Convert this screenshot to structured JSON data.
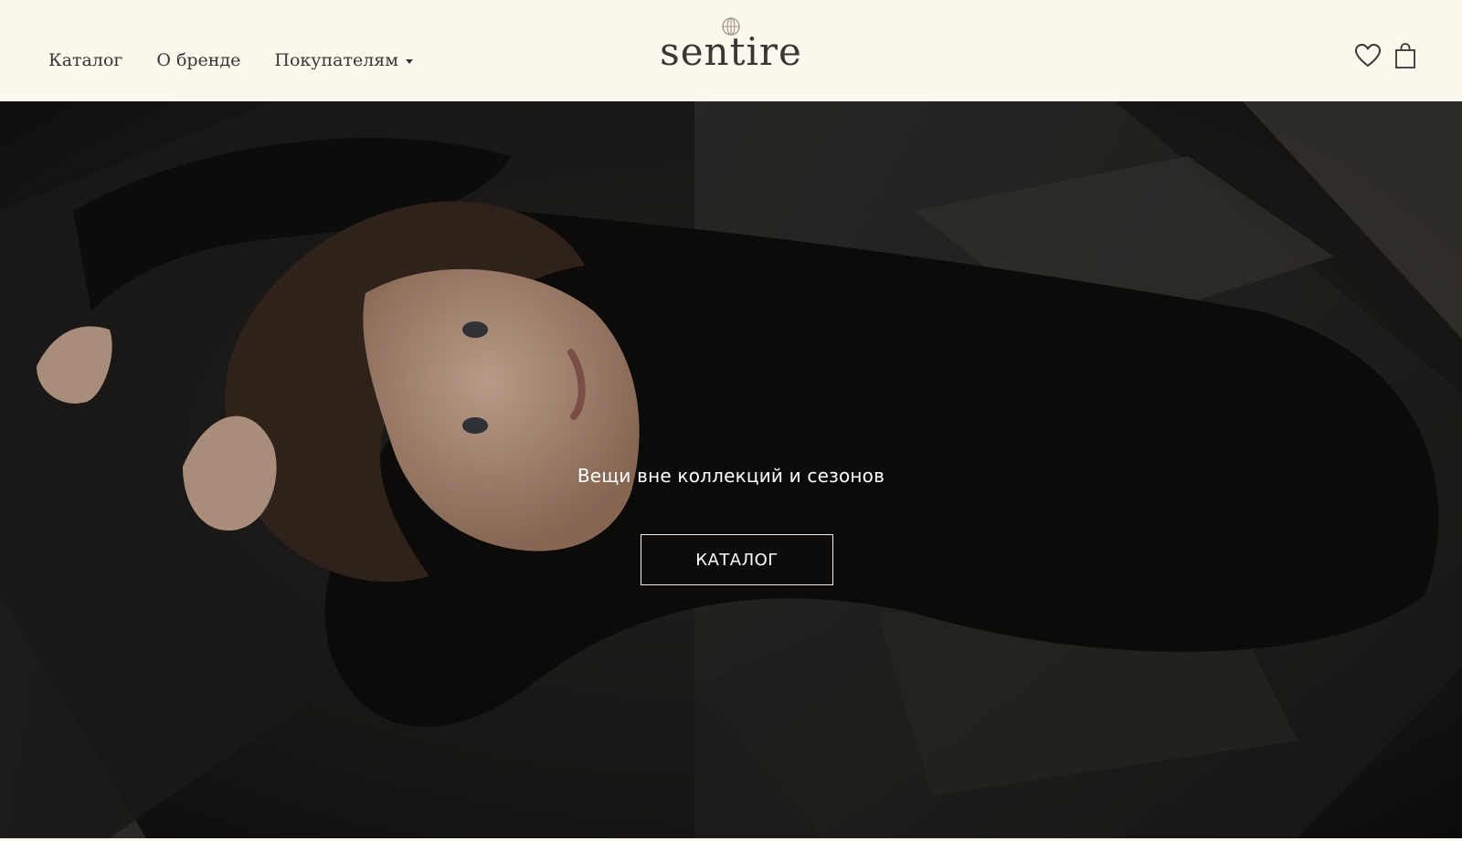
{
  "header": {
    "nav": {
      "catalog": "Каталог",
      "about": "О бренде",
      "customers": "Покупателям"
    },
    "logo": "sentire",
    "icons": [
      "heart-icon",
      "shopping-bag-icon"
    ]
  },
  "hero": {
    "tagline": "Вещи вне коллекций и сезонов",
    "button_label": "КАТАЛОГ"
  },
  "colors": {
    "header_bg": "#fdf8ee",
    "text": "#3a3530",
    "hero_text": "#ffffff"
  }
}
